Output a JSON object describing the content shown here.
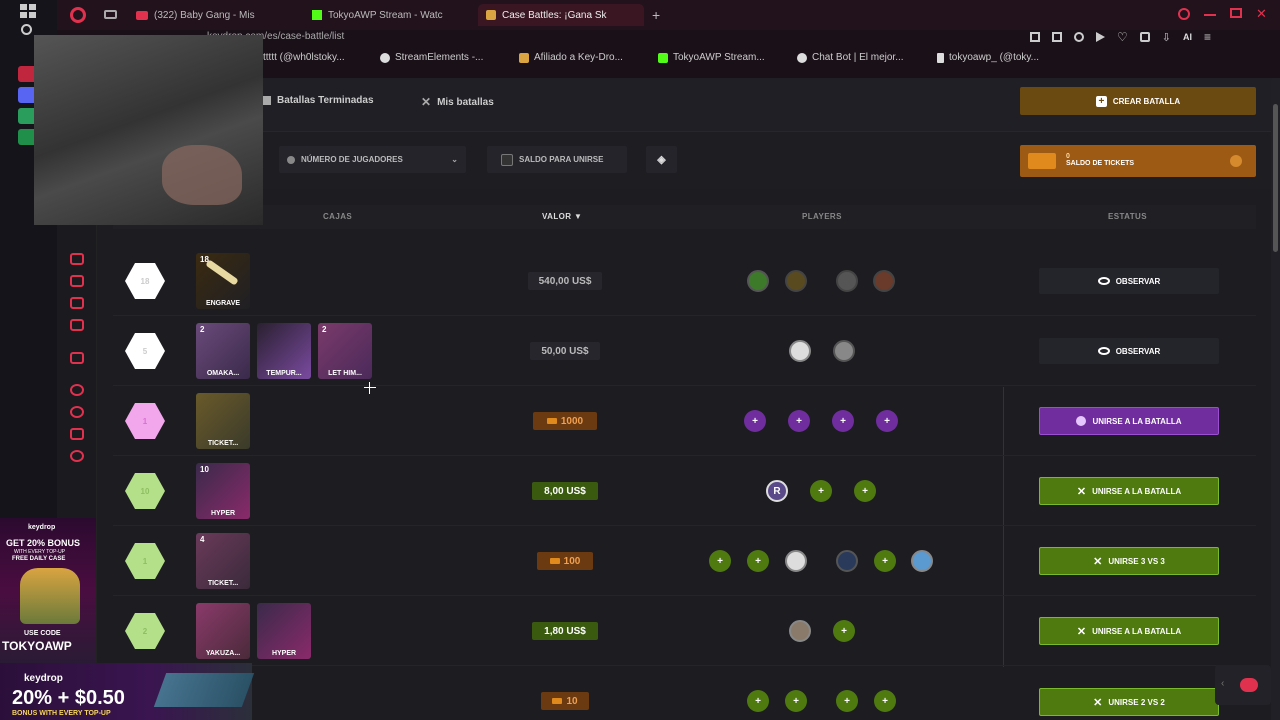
{
  "browser": {
    "tabs": [
      {
        "label": "(322) Baby Gang - Mis"
      },
      {
        "label": "TokyoAWP Stream - Watc"
      },
      {
        "label": "Case Battles: ¡Gana Sk"
      }
    ],
    "new_tab": "+",
    "url": "keydrop.com/es/case-battle/list",
    "bookmarks": [
      "ttttt (@wh0lstoky...",
      "StreamElements -...",
      "Afiliado a Key-Dro...",
      "TokyoAWP Stream...",
      "Chat Bot | El mejor...",
      "tokyoawp_ (@toky..."
    ],
    "ai_label": "AI"
  },
  "subnav": {
    "finished_battles": "Batallas Terminadas",
    "my_battles": "Mis batallas",
    "create_battle": "CREAR BATALLA"
  },
  "filters": {
    "players_dropdown": "NÚMERO DE JUGADORES",
    "balance_checkbox": "SALDO PARA UNIRSE",
    "tickets_count": "0",
    "tickets_label": "SALDO DE TICKETS"
  },
  "table": {
    "headers": {
      "cases": "CAJAS",
      "value": "VALOR ▼",
      "players": "PLAYERS",
      "status": "ESTATUS"
    }
  },
  "rows": [
    {
      "level": "18",
      "cases": [
        {
          "count": "18",
          "name": "ENGRAVE"
        }
      ],
      "price": "540,00 US$",
      "action": "OBSERVAR"
    },
    {
      "level": "5",
      "cases": [
        {
          "count": "2",
          "name": "OMAKA..."
        },
        {
          "count": "",
          "name": "TEMPUR..."
        },
        {
          "count": "2",
          "name": "LET HIM..."
        }
      ],
      "price": "50,00 US$",
      "action": "OBSERVAR"
    },
    {
      "level": "1",
      "cases": [
        {
          "count": "",
          "name": "TICKET..."
        }
      ],
      "price": "1000",
      "action": "UNIRSE A LA BATALLA"
    },
    {
      "level": "10",
      "cases": [
        {
          "count": "10",
          "name": "HYPER"
        }
      ],
      "price": "8,00 US$",
      "action": "UNIRSE A LA BATALLA"
    },
    {
      "level": "1",
      "cases": [
        {
          "count": "4",
          "name": "TICKET..."
        }
      ],
      "price": "100",
      "action": "UNIRSE 3 VS 3"
    },
    {
      "level": "2",
      "cases": [
        {
          "count": "",
          "name": "YAKUZA..."
        },
        {
          "count": "",
          "name": "HYPER"
        }
      ],
      "price": "1,80 US$",
      "action": "UNIRSE A LA BATALLA"
    },
    {
      "level": "",
      "cases": [
        {
          "count": "",
          "name": ""
        }
      ],
      "price": "10",
      "action": "UNIRSE 2 VS 2"
    }
  ],
  "ads": {
    "ad1_brand": "keydrop",
    "ad1_line1": "GET 20% BONUS",
    "ad1_line2": "WITH EVERY TOP-UP",
    "ad1_line3": "FREE DAILY CASE",
    "ad1_code_label": "USE CODE",
    "ad1_code": "TOKYOAWP",
    "ad2_brand": "keydrop",
    "ad2_headline": "20% + $0.50",
    "ad2_sub": "BONUS WITH EVERY TOP-UP"
  },
  "colors": {
    "accent_red": "#e0314f",
    "gold": "#6b4a12",
    "green": "#4f7a10",
    "purple": "#6f2d9e"
  }
}
